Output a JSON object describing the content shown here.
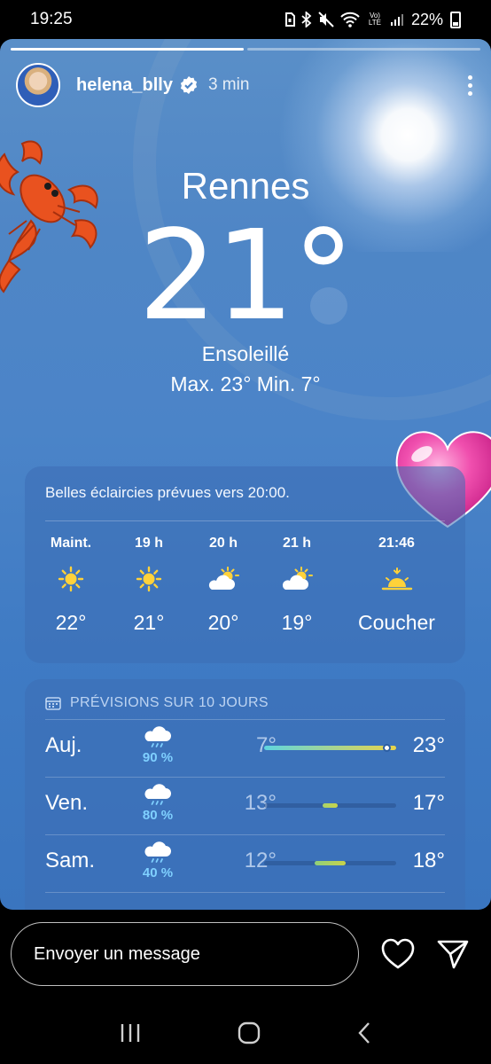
{
  "status_bar": {
    "time": "19:25",
    "battery": "22%",
    "network": "Vo) LTE"
  },
  "story": {
    "progress": [
      1.0,
      0.0
    ],
    "username": "helena_blly",
    "verified": true,
    "time_ago": "3 min"
  },
  "weather": {
    "city": "Rennes",
    "temperature": "21°",
    "condition": "Ensoleillé",
    "hi_lo": "Max. 23°  Min. 7°"
  },
  "hourly": {
    "summary": "Belles éclaircies prévues vers 20:00.",
    "items": [
      {
        "label": "Maint.",
        "icon": "sun-icon",
        "value": "22°"
      },
      {
        "label": "19 h",
        "icon": "sun-icon",
        "value": "21°"
      },
      {
        "label": "20 h",
        "icon": "partly-cloudy-icon",
        "value": "20°"
      },
      {
        "label": "21 h",
        "icon": "partly-cloudy-icon",
        "value": "19°"
      },
      {
        "label": "21:46",
        "icon": "sunset-icon",
        "value": "Coucher"
      }
    ]
  },
  "daily": {
    "header": "PRÉVISIONS SUR 10 JOURS",
    "range_min": 7,
    "range_max": 23,
    "days": [
      {
        "name": "Auj.",
        "icon": "rain-cloud-icon",
        "precip": "90 %",
        "min": "7°",
        "max": "23°",
        "low": 7,
        "high": 23,
        "current": 21,
        "colors": [
          "#5fd5e0",
          "#e8d44a"
        ]
      },
      {
        "name": "Ven.",
        "icon": "rain-cloud-icon",
        "precip": "80 %",
        "min": "13°",
        "max": "17°",
        "low": 13,
        "high": 17,
        "colors": [
          "#a8d36a",
          "#c8d34a"
        ]
      },
      {
        "name": "Sam.",
        "icon": "rain-cloud-icon",
        "precip": "40 %",
        "min": "12°",
        "max": "18°",
        "low": 12,
        "high": 18,
        "colors": [
          "#8fd07a",
          "#c8d34a"
        ]
      }
    ]
  },
  "reply": {
    "placeholder": "Envoyer un message"
  }
}
